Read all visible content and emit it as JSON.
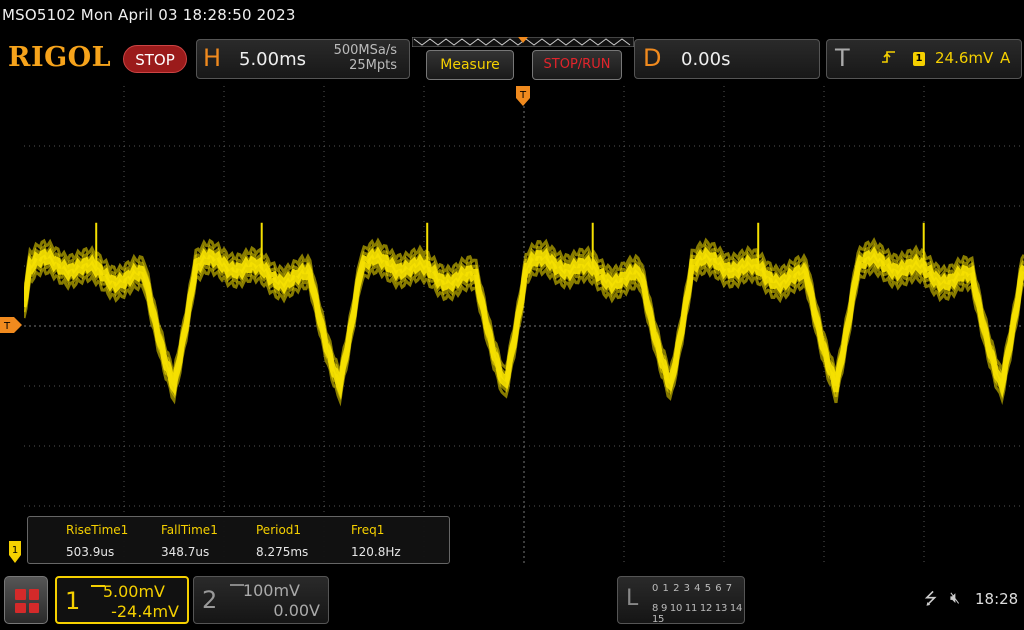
{
  "title_bar": {
    "text": "MSO5102  Mon April 03 18:28:50 2023"
  },
  "top_bar": {
    "logo": "RIGOL",
    "run_state": "STOP",
    "horizontal": {
      "letter": "H",
      "timebase": "5.00ms",
      "sample_rate": "500MSa/s",
      "memory_depth": "25Mpts"
    },
    "measure_button": "Measure",
    "stop_run_button": "STOP/RUN",
    "delay": {
      "letter": "D",
      "value": "0.00s"
    },
    "trigger": {
      "letter": "T",
      "edge_icon": "rising-edge-icon",
      "source": "1",
      "level": "24.6mV",
      "mode": "A"
    }
  },
  "screen": {
    "trigger_position_marker": "T",
    "trigger_level_marker": "T",
    "channel_marker": "1",
    "waveform": {
      "channel": "1",
      "color": "#f5e000",
      "period_ms": 8.275,
      "frequency_hz": 120.8,
      "description_units": "divisions"
    }
  },
  "measurements": [
    {
      "name": "RiseTime1",
      "value": "503.9us"
    },
    {
      "name": "FallTime1",
      "value": "348.7us"
    },
    {
      "name": "Period1",
      "value": "8.275ms"
    },
    {
      "name": "Freq1",
      "value": "120.8Hz"
    }
  ],
  "bottom_bar": {
    "ch1": {
      "number": "1",
      "scale": "5.00mV",
      "offset": "-24.4mV"
    },
    "ch2": {
      "number": "2",
      "scale": "100mV",
      "offset": "0.00V"
    },
    "la": {
      "letter": "L",
      "row1": "0 1 2 3  4 5 6 7",
      "row2": "8 9 10 11 12 13 14 15"
    },
    "clock": "18:28"
  },
  "colors": {
    "accent": "#f08a1e",
    "ch1": "#f5d000",
    "stop": "#9b1b1b",
    "stoprun": "#e2242b"
  }
}
